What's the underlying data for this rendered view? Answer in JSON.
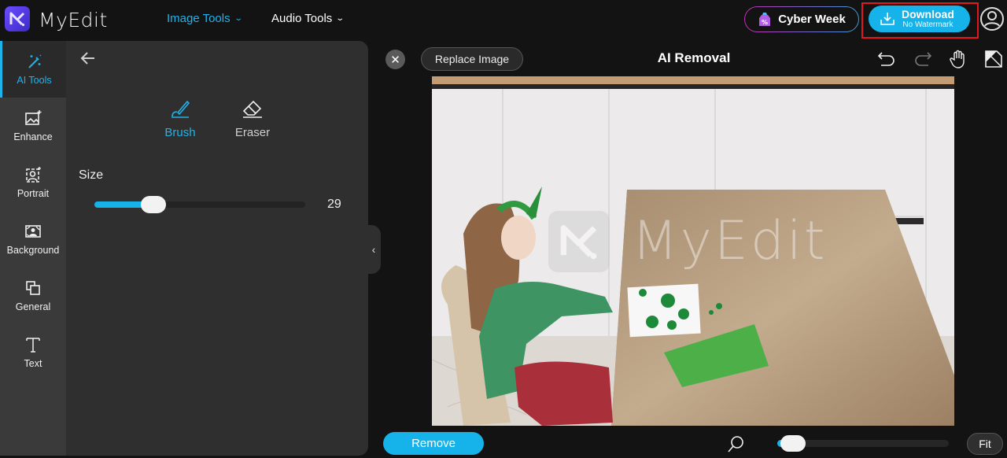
{
  "header": {
    "app_name": "MyEdit",
    "nav": [
      {
        "label": "Image Tools",
        "active": true
      },
      {
        "label": "Audio Tools",
        "active": false
      }
    ],
    "promo_label": "Cyber Week",
    "download": {
      "label": "Download",
      "sublabel": "No Watermark"
    }
  },
  "sidebar": {
    "items": [
      {
        "label": "AI Tools",
        "icon": "magic-wand-icon",
        "active": true
      },
      {
        "label": "Enhance",
        "icon": "image-enhance-icon"
      },
      {
        "label": "Portrait",
        "icon": "portrait-icon"
      },
      {
        "label": "Background",
        "icon": "background-icon"
      },
      {
        "label": "General",
        "icon": "general-icon"
      },
      {
        "label": "Text",
        "icon": "text-icon"
      }
    ]
  },
  "panel": {
    "tools": [
      {
        "label": "Brush",
        "active": true
      },
      {
        "label": "Eraser",
        "active": false
      }
    ],
    "size_label": "Size",
    "size_value": "29",
    "size_fraction": 0.28
  },
  "editor": {
    "replace_label": "Replace Image",
    "title": "AI Removal",
    "watermark": "MyEdit",
    "remove_label": "Remove",
    "fit_label": "Fit",
    "zoom_fraction": 0.09
  },
  "colors": {
    "accent": "#15b3ea",
    "highlight_frame": "#e3171d"
  }
}
